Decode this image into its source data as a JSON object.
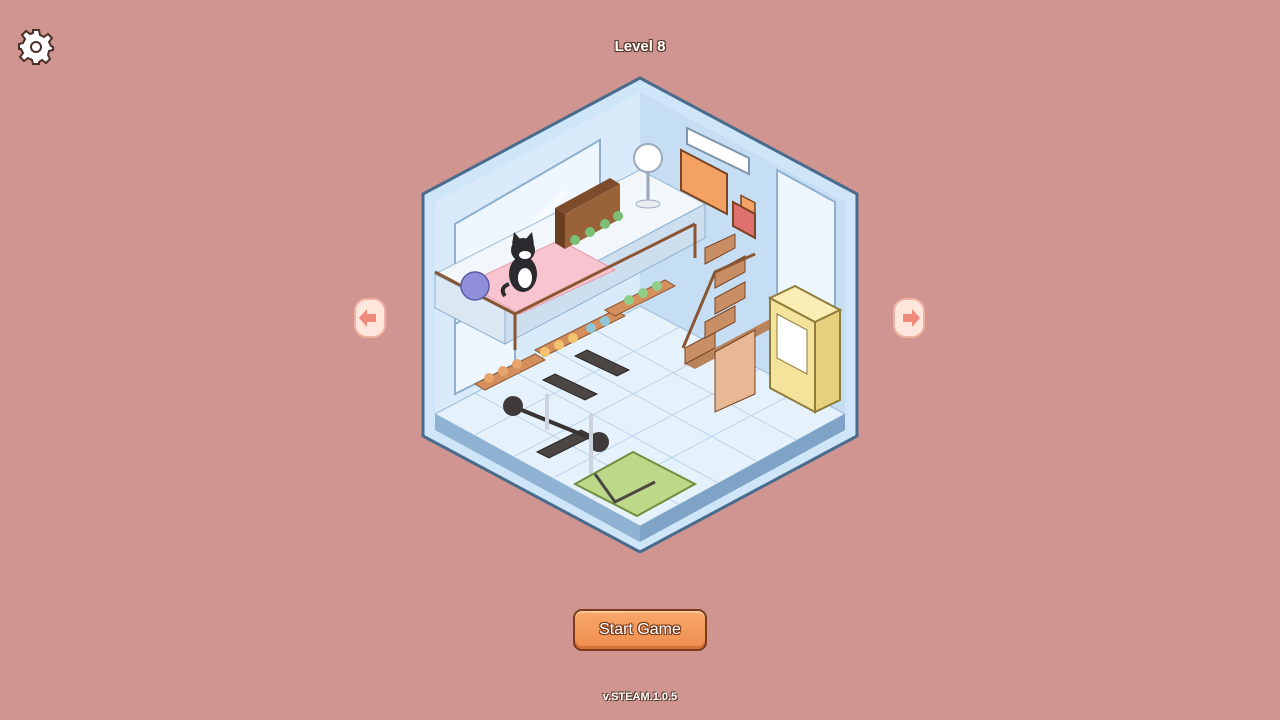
{
  "header": {
    "level_label": "Level 8"
  },
  "icons": {
    "settings": "gear-icon",
    "prev": "arrow-left-icon",
    "next": "arrow-right-icon",
    "room": "isometric-gym-room",
    "cat": "cat-icon"
  },
  "actions": {
    "start_label": "Start Game"
  },
  "footer": {
    "version": "v.STEAM.1.0.5"
  },
  "colors": {
    "background": "#d09590",
    "start_button": "#f39b5c",
    "room_wall": "#bcdaf3",
    "room_outline": "#4a6c8c"
  }
}
